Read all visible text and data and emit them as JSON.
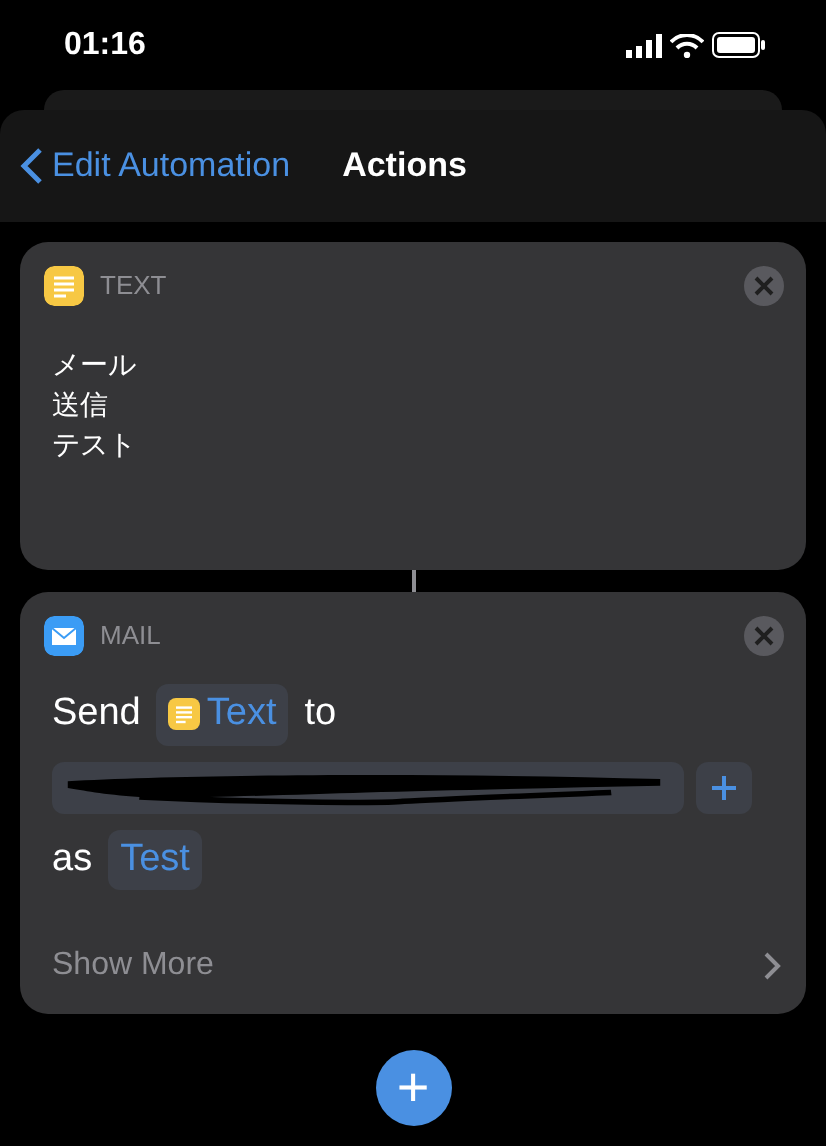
{
  "status_bar": {
    "time": "01:16"
  },
  "nav": {
    "back": "Edit Automation",
    "title": "Actions"
  },
  "actions": [
    {
      "kind": "text",
      "header": "TEXT",
      "body": [
        "メール",
        "送信",
        "テスト"
      ]
    },
    {
      "kind": "mail",
      "header": "MAIL",
      "send_label": "Send",
      "content_token": "Text",
      "to_label": "to",
      "recipient": {
        "redacted": true
      },
      "as_label": "as",
      "account_token": "Test",
      "show_more": "Show More"
    }
  ],
  "add_button": "+"
}
